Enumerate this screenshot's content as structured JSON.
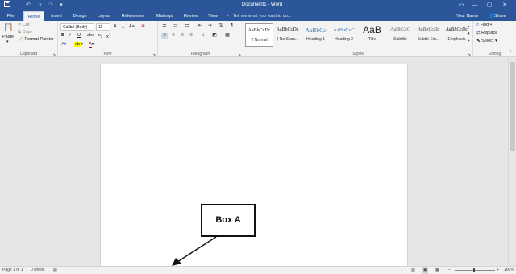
{
  "titlebar": {
    "doc_title": "Document1 - Word",
    "save_icon": "save-icon",
    "undo_icon": "undo-icon",
    "redo_icon": "redo-icon",
    "customize_icon": "customize-icon",
    "controls": [
      "ribbon-display-icon",
      "minimize-icon",
      "maximize-icon",
      "close-icon"
    ]
  },
  "tabs": {
    "items": [
      {
        "label": "File"
      },
      {
        "label": "Home"
      },
      {
        "label": "Insert"
      },
      {
        "label": "Design"
      },
      {
        "label": "Layout"
      },
      {
        "label": "References"
      },
      {
        "label": "Mailings"
      },
      {
        "label": "Review"
      },
      {
        "label": "View"
      }
    ],
    "active": "Home",
    "tell_me": "Tell me what you want to do...",
    "user": "Your Name",
    "share": "Share"
  },
  "ribbon": {
    "clipboard": {
      "label": "Clipboard",
      "paste": "Paste",
      "cut": "Cut",
      "copy": "Copy",
      "format_painter": "Format Painter"
    },
    "font": {
      "label": "Font",
      "font_name": "Calibri (Body)",
      "font_size": "11",
      "grow": "A",
      "shrink": "A",
      "case": "Aa",
      "bold": "B",
      "italic": "I",
      "underline": "U",
      "strike": "abc",
      "subscript": "x",
      "superscript": "x",
      "highlight_color": "#ffff00",
      "font_color": "#d00000"
    },
    "paragraph": {
      "label": "Paragraph"
    },
    "styles": {
      "label": "Styles",
      "items": [
        {
          "preview": "AaBbCcDc",
          "name": "¶ Normal"
        },
        {
          "preview": "AaBbCcDc",
          "name": "¶ No Spac..."
        },
        {
          "preview": "AaBbCc",
          "name": "Heading 1"
        },
        {
          "preview": "AaBbCcC",
          "name": "Heading 2"
        },
        {
          "preview": "AaB",
          "name": "Title"
        },
        {
          "preview": "AaBbCcC",
          "name": "Subtitle"
        },
        {
          "preview": "AaBbCcDc",
          "name": "Subtle Em..."
        },
        {
          "preview": "AaBbCcDc",
          "name": "Emphasis"
        }
      ]
    },
    "editing": {
      "label": "Editing",
      "find": "Find",
      "replace": "Replace",
      "select": "Select"
    }
  },
  "statusbar": {
    "page": "Page 1 of 1",
    "words": "0 words",
    "zoom": "100%"
  },
  "callout": {
    "label": "Box A"
  },
  "colors": {
    "brand": "#2b579a",
    "ribbon": "#f3f3f3",
    "canvas": "#e6e6e6"
  }
}
